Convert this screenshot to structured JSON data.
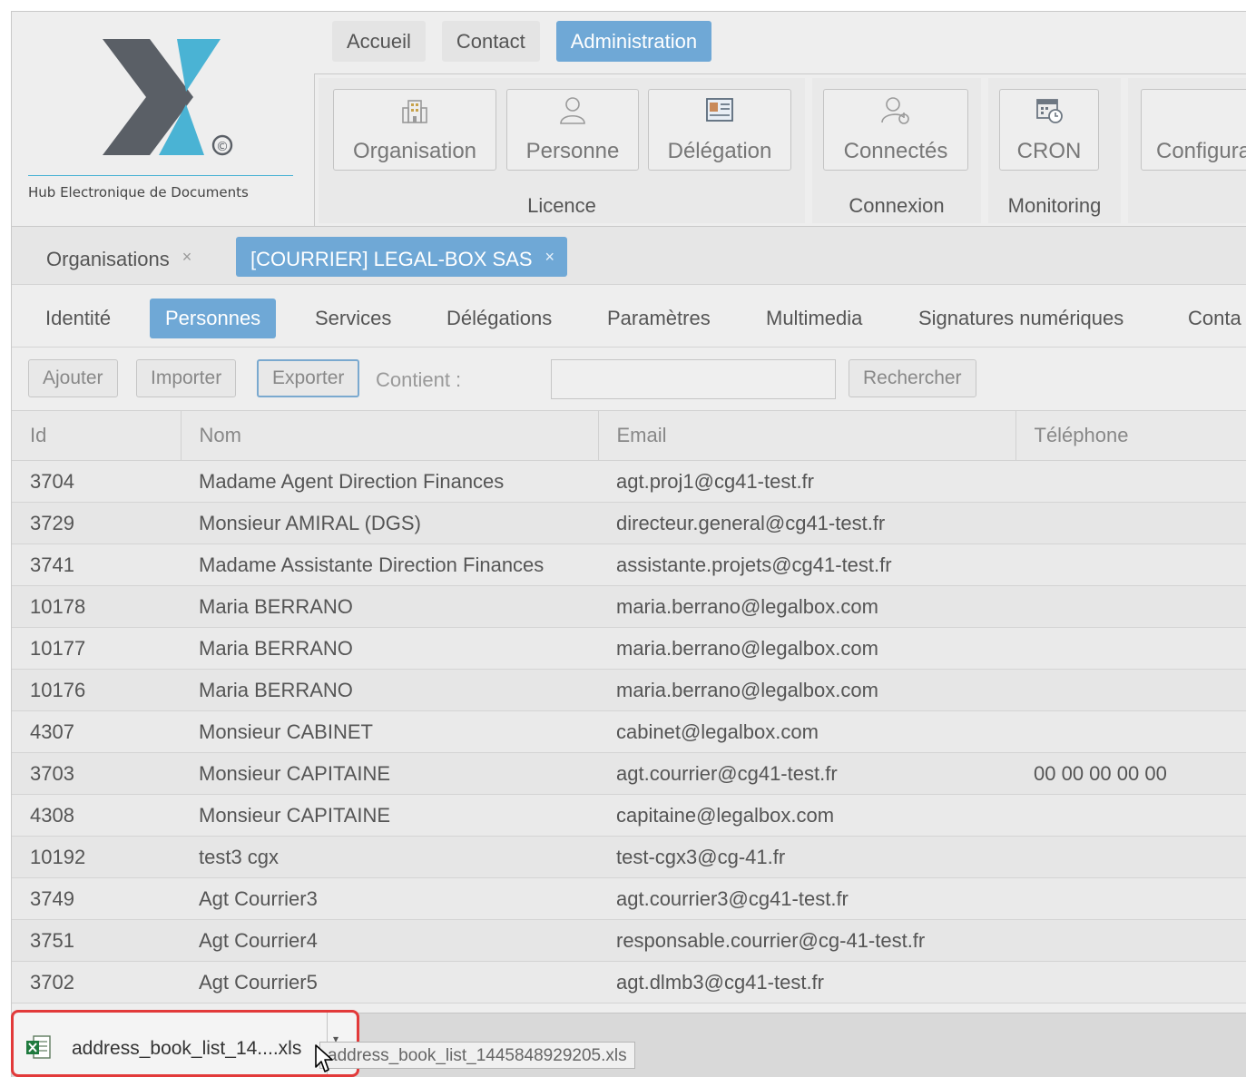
{
  "logo": {
    "caption": "Hub Electronique de Documents",
    "copyright_mark": "©"
  },
  "top_nav": {
    "tabs": [
      {
        "label": "Accueil",
        "active": false
      },
      {
        "label": "Contact",
        "active": false
      },
      {
        "label": "Administration",
        "active": true
      }
    ]
  },
  "ribbon": {
    "groups": [
      {
        "label": "Licence",
        "buttons": [
          {
            "label": "Organisation",
            "icon": "building-icon"
          },
          {
            "label": "Personne",
            "icon": "person-icon"
          },
          {
            "label": "Délégation",
            "icon": "id-card-icon"
          }
        ]
      },
      {
        "label": "Connexion",
        "buttons": [
          {
            "label": "Connectés",
            "icon": "user-power-icon"
          }
        ]
      },
      {
        "label": "Monitoring",
        "buttons": [
          {
            "label": "CRON",
            "icon": "calendar-clock-icon"
          }
        ]
      },
      {
        "label": "",
        "buttons": [
          {
            "label": "Configura",
            "icon": "gears-icon"
          }
        ]
      }
    ]
  },
  "doc_tabs": [
    {
      "label": "Organisations",
      "close": "×",
      "active": false
    },
    {
      "label": "[COURRIER] LEGAL-BOX SAS",
      "close": "×",
      "active": true
    }
  ],
  "sub_tabs": [
    {
      "label": "Identité",
      "active": false
    },
    {
      "label": "Personnes",
      "active": true
    },
    {
      "label": "Services",
      "active": false
    },
    {
      "label": "Délégations",
      "active": false
    },
    {
      "label": "Paramètres",
      "active": false
    },
    {
      "label": "Multimedia",
      "active": false
    },
    {
      "label": "Signatures numériques",
      "active": false
    },
    {
      "label": "Conta",
      "active": false
    }
  ],
  "toolbar": {
    "add": "Ajouter",
    "import": "Importer",
    "export": "Exporter",
    "contains_label": "Contient :",
    "search_value": "",
    "search_button": "Rechercher"
  },
  "table": {
    "columns": [
      "Id",
      "Nom",
      "Email",
      "Téléphone"
    ],
    "rows": [
      [
        "3704",
        "Madame Agent Direction Finances",
        "agt.proj1@cg41-test.fr",
        ""
      ],
      [
        "3729",
        "Monsieur AMIRAL (DGS)",
        "directeur.general@cg41-test.fr",
        ""
      ],
      [
        "3741",
        "Madame Assistante Direction Finances",
        "assistante.projets@cg41-test.fr",
        ""
      ],
      [
        "10178",
        "Maria BERRANO",
        "maria.berrano@legalbox.com",
        ""
      ],
      [
        "10177",
        "Maria BERRANO",
        "maria.berrano@legalbox.com",
        ""
      ],
      [
        "10176",
        "Maria BERRANO",
        "maria.berrano@legalbox.com",
        ""
      ],
      [
        "4307",
        "Monsieur CABINET",
        "cabinet@legalbox.com",
        ""
      ],
      [
        "3703",
        "Monsieur CAPITAINE",
        "agt.courrier@cg41-test.fr",
        "00 00 00 00 00"
      ],
      [
        "4308",
        "Monsieur CAPITAINE",
        "capitaine@legalbox.com",
        ""
      ],
      [
        "10192",
        "test3 cgx",
        "test-cgx3@cg-41.fr",
        ""
      ],
      [
        "3749",
        "Agt Courrier3",
        "agt.courrier3@cg41-test.fr",
        ""
      ],
      [
        "3751",
        "Agt Courrier4",
        "responsable.courrier@cg-41-test.fr",
        ""
      ],
      [
        "3702",
        "Agt Courrier5",
        "agt.dlmb3@cg41-test.fr",
        ""
      ]
    ]
  },
  "download": {
    "file_label": "address_book_list_14....xls",
    "menu_glyph": "▾",
    "tooltip": "address_book_list_1445848929205.xls",
    "icon": "excel-file-icon"
  },
  "colors": {
    "accent": "#6fa8d6",
    "logo_dark": "#5a5f66",
    "logo_light": "#4ab3d4",
    "highlight": "#e23a3a"
  }
}
